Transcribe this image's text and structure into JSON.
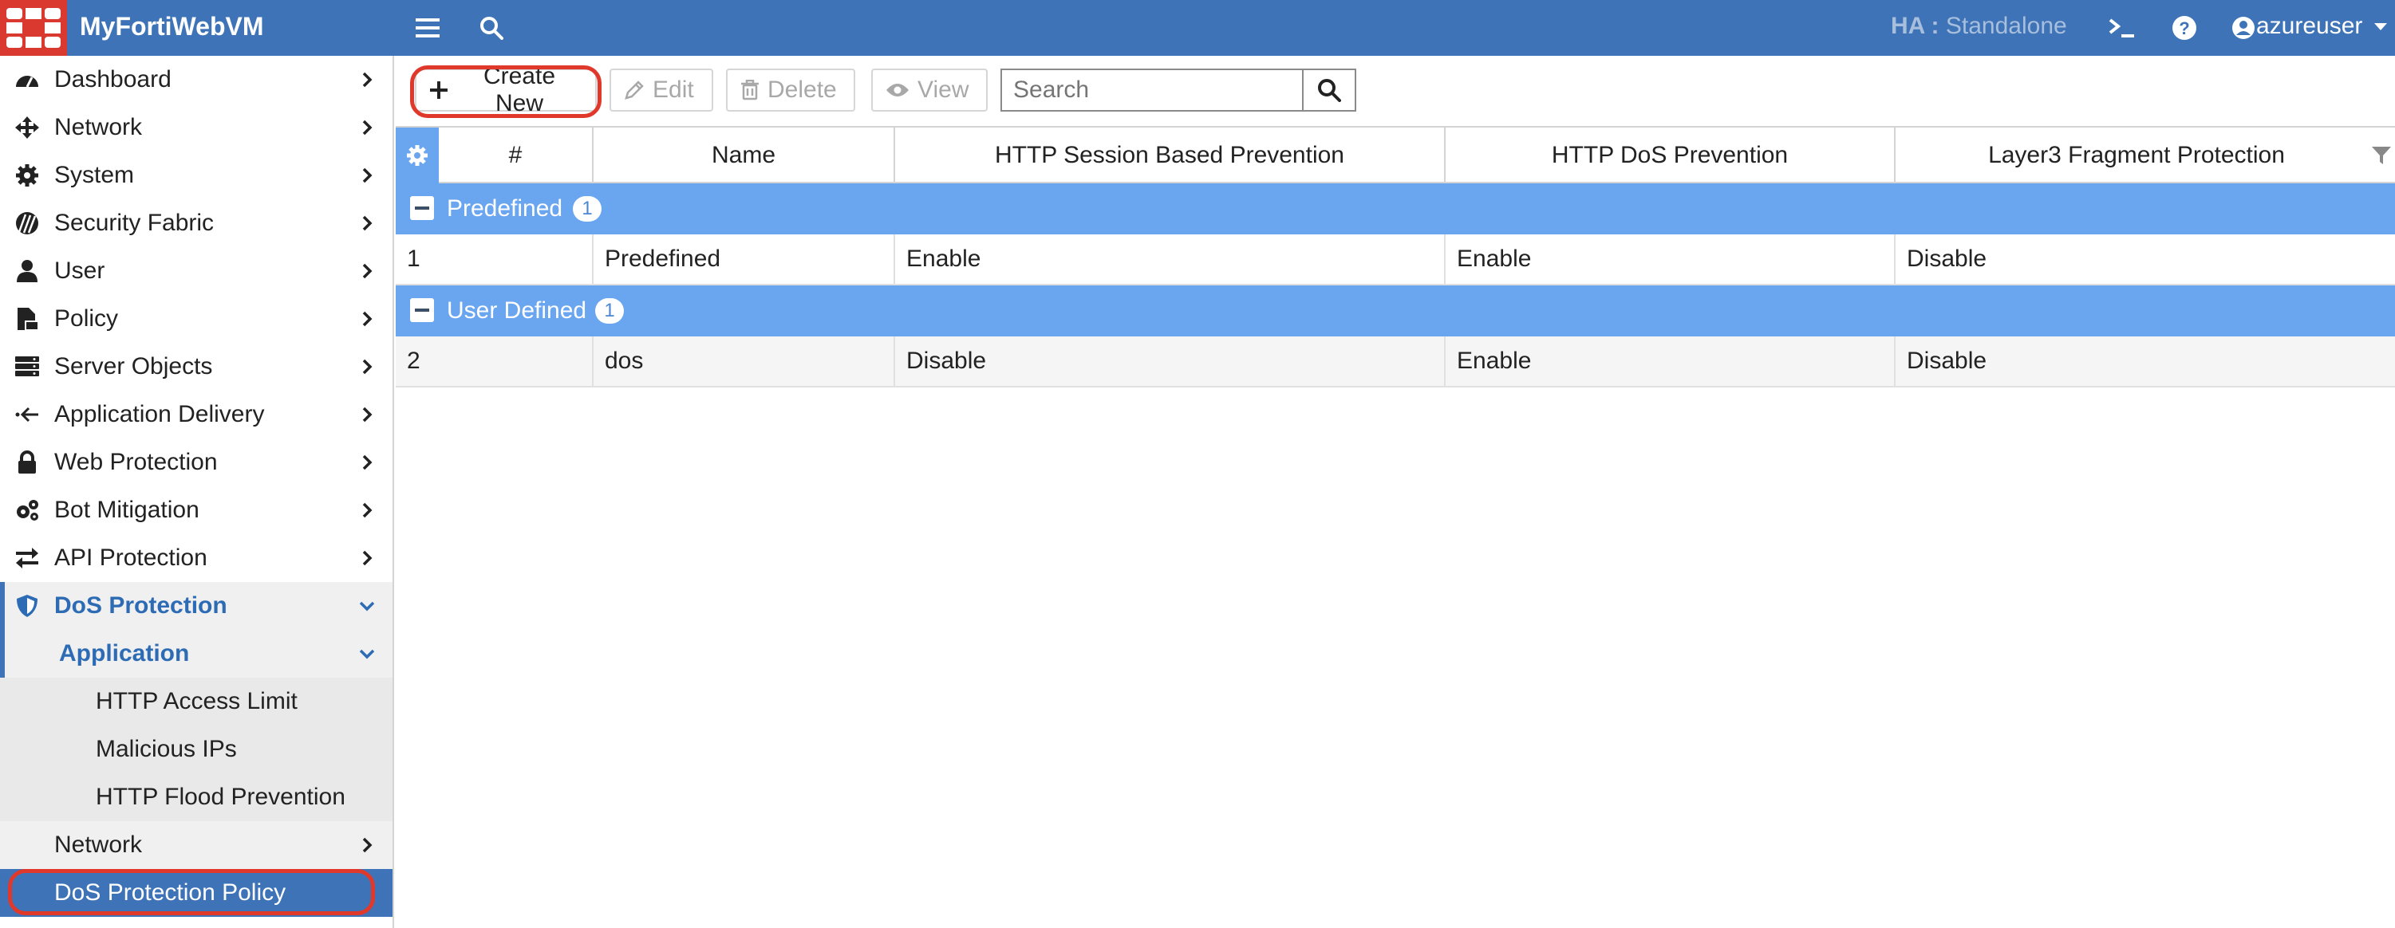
{
  "header": {
    "app_title": "MyFortiWebVM",
    "ha_label": "HA :",
    "ha_value": "Standalone",
    "user_name": "azureuser",
    "brand_color": "#3e74b7",
    "logo_color": "#d9392e"
  },
  "sidebar": {
    "items": [
      {
        "label": "Dashboard",
        "icon": "dashboard-icon"
      },
      {
        "label": "Network",
        "icon": "network-icon"
      },
      {
        "label": "System",
        "icon": "gear-icon"
      },
      {
        "label": "Security Fabric",
        "icon": "security-fabric-icon"
      },
      {
        "label": "User",
        "icon": "user-icon"
      },
      {
        "label": "Policy",
        "icon": "policy-icon"
      },
      {
        "label": "Server Objects",
        "icon": "server-icon"
      },
      {
        "label": "Application Delivery",
        "icon": "app-delivery-icon"
      },
      {
        "label": "Web Protection",
        "icon": "lock-icon"
      },
      {
        "label": "Bot Mitigation",
        "icon": "cogs-icon"
      },
      {
        "label": "API Protection",
        "icon": "exchange-icon"
      }
    ],
    "dos": {
      "label": "DoS Protection",
      "application": "Application",
      "app_children": [
        "HTTP Access Limit",
        "Malicious IPs",
        "HTTP Flood Prevention"
      ],
      "network": "Network",
      "policy": "DoS Protection Policy"
    }
  },
  "toolbar": {
    "create_new": "Create New",
    "edit": "Edit",
    "delete": "Delete",
    "view": "View",
    "search_placeholder": "Search"
  },
  "table": {
    "columns": [
      "#",
      "Name",
      "HTTP Session Based Prevention",
      "HTTP DoS Prevention",
      "Layer3 Fragment Protection"
    ],
    "groups": [
      {
        "label": "Predefined",
        "count": "1",
        "rows": [
          [
            "1",
            "Predefined",
            "Enable",
            "Enable",
            "Disable"
          ]
        ]
      },
      {
        "label": "User Defined",
        "count": "1",
        "rows": [
          [
            "2",
            "dos",
            "Disable",
            "Enable",
            "Disable"
          ]
        ]
      }
    ],
    "group_color": "#6aa5f0"
  },
  "highlight_color": "#e0392c"
}
